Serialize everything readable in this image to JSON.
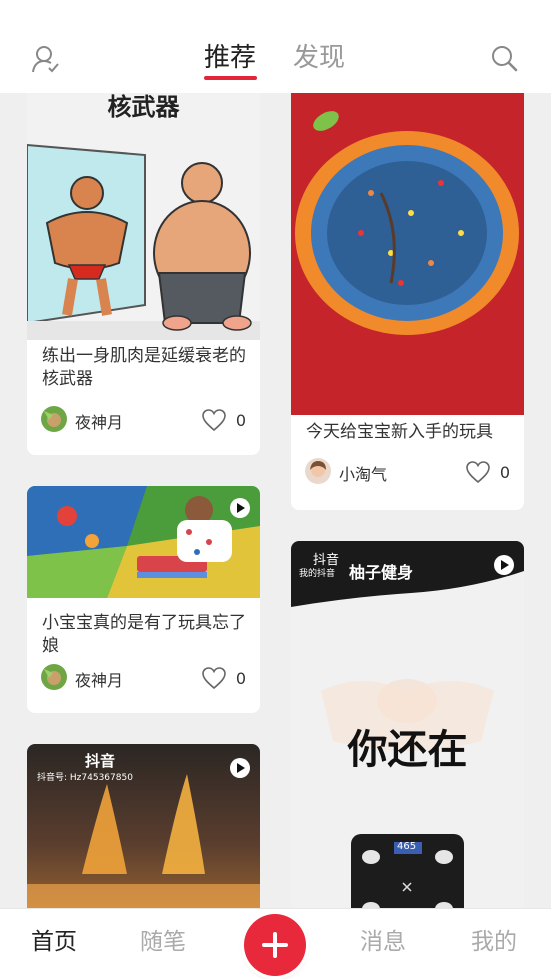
{
  "header": {
    "tabs": [
      {
        "label": "推荐",
        "active": true
      },
      {
        "label": "发现",
        "active": false
      }
    ],
    "accent_color": "#e3253a"
  },
  "feed": {
    "left_column": [
      {
        "image_text": "核武器",
        "caption": "练出一身肌肉是延缓衰老的核武器",
        "author": "夜神月",
        "likes": "0",
        "is_video": false
      },
      {
        "caption": "小宝宝真的是有了玩具忘了娘",
        "author": "夜神月",
        "likes": "0",
        "is_video": true
      },
      {
        "watermark_app": "抖音",
        "watermark_id": "抖音号: Hz745367850",
        "is_video": true
      }
    ],
    "right_column": [
      {
        "caption": "今天给宝宝新入手的玩具",
        "author": "小淘气",
        "likes": "0",
        "is_video": false
      },
      {
        "watermark_app": "抖音",
        "watermark_sub": "我的抖音",
        "banner_text": "柚子健身",
        "overlay_text": "你还在",
        "scale_reading": "465",
        "is_video": true
      }
    ]
  },
  "bottom_nav": {
    "items": [
      {
        "label": "首页",
        "active": true
      },
      {
        "label": "随笔",
        "active": false
      },
      {
        "label": "消息",
        "active": false
      },
      {
        "label": "我的",
        "active": false
      }
    ],
    "add_icon": "plus-icon"
  }
}
